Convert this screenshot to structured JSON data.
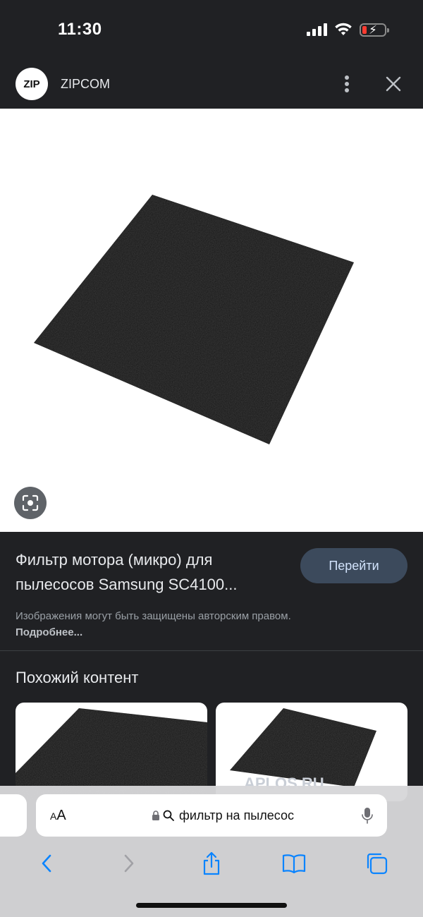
{
  "status_bar": {
    "time": "11:30"
  },
  "header": {
    "logo_text": "ZIP",
    "site_name": "ZIPCOM"
  },
  "result": {
    "title": "Фильтр мотора (микро) для пылесосов Samsung SC4100...",
    "visit_label": "Перейти",
    "copyright_text": "Изображения могут быть защищены авторским правом.",
    "learn_more_label": "Подробнее..."
  },
  "similar": {
    "title": "Похожий контент",
    "watermark": "APLOS.RU"
  },
  "address_bar": {
    "aa_label": "AA",
    "query": "фильтр на пылесос"
  },
  "colors": {
    "accent_button": "#3c4a5c",
    "battery_low": "#ff3b30",
    "safari_blue": "#0a84ff"
  }
}
